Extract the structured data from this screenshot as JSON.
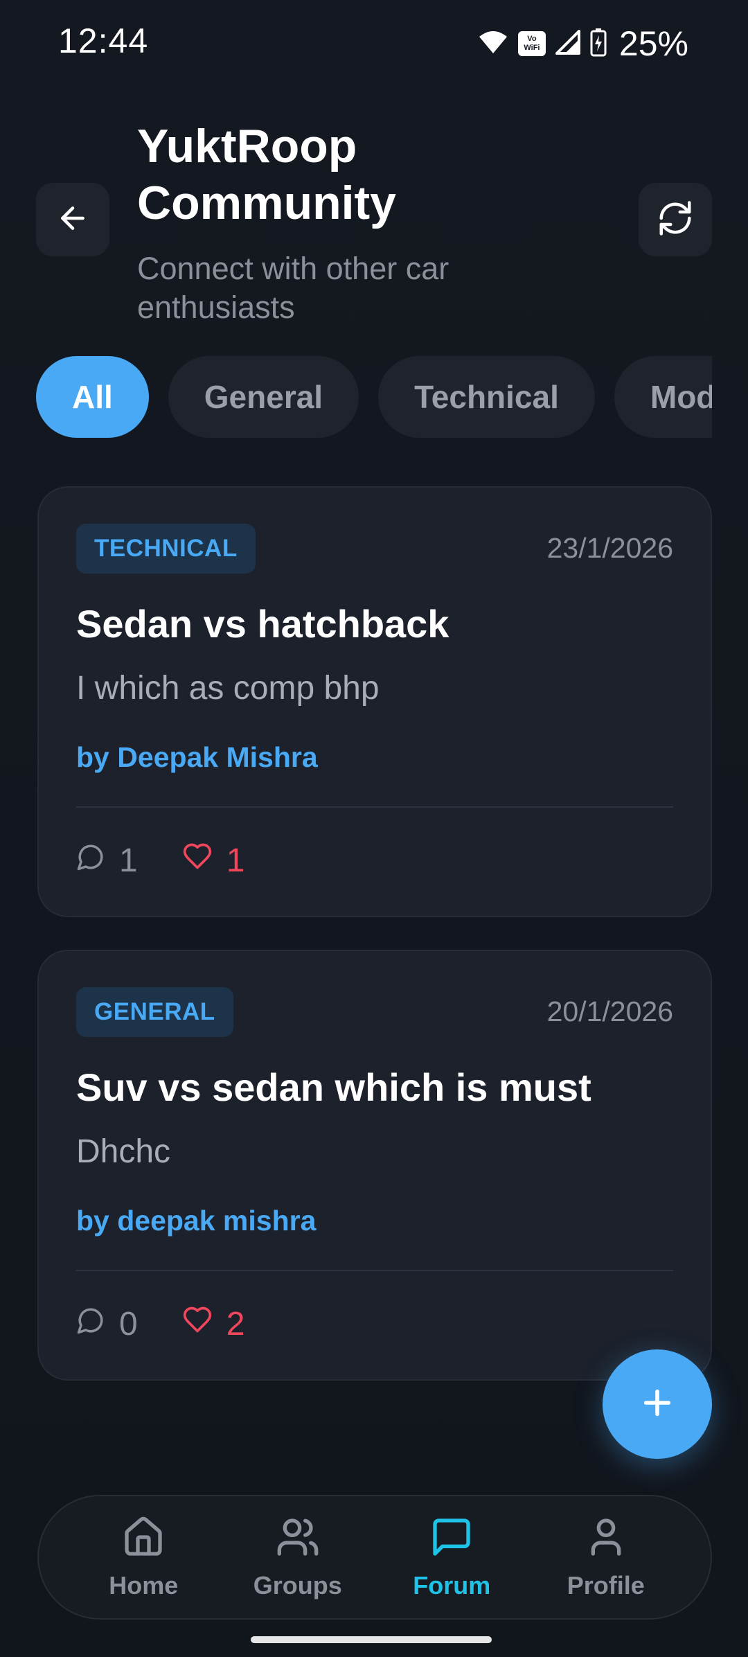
{
  "status_bar": {
    "time": "12:44",
    "battery_percent": "25%",
    "vowifi_text": "Vo WiFi",
    "icons": [
      "wifi-icon",
      "vowifi-icon",
      "signal-icon",
      "battery-charging-icon"
    ]
  },
  "header": {
    "title": "YuktRoop Community",
    "subtitle": "Connect with other car enthusiasts",
    "back_icon": "arrow-left-icon",
    "refresh_icon": "refresh-icon"
  },
  "filters": {
    "items": [
      "All",
      "General",
      "Technical",
      "Mods"
    ],
    "active": "All"
  },
  "posts": [
    {
      "category": "TECHNICAL",
      "date": "23/1/2026",
      "title": "Sedan vs hatchback",
      "body": "I which as comp bhp",
      "author": "by Deepak Mishra",
      "comments": "1",
      "likes": "1"
    },
    {
      "category": "GENERAL",
      "date": "20/1/2026",
      "title": "Suv vs sedan which is must",
      "body": "Dhchc",
      "author": "by deepak mishra",
      "comments": "0",
      "likes": "2"
    }
  ],
  "fab": {
    "icon": "plus-icon"
  },
  "nav": {
    "items": [
      {
        "label": "Home",
        "icon": "home-icon"
      },
      {
        "label": "Groups",
        "icon": "users-icon"
      },
      {
        "label": "Forum",
        "icon": "chat-icon"
      },
      {
        "label": "Profile",
        "icon": "user-icon"
      }
    ],
    "active": "Forum"
  },
  "colors": {
    "accent": "#4aa9f5",
    "nav_active": "#1fc3e8",
    "like": "#f0475d",
    "background": "#12161d",
    "card": "#1c212b"
  }
}
